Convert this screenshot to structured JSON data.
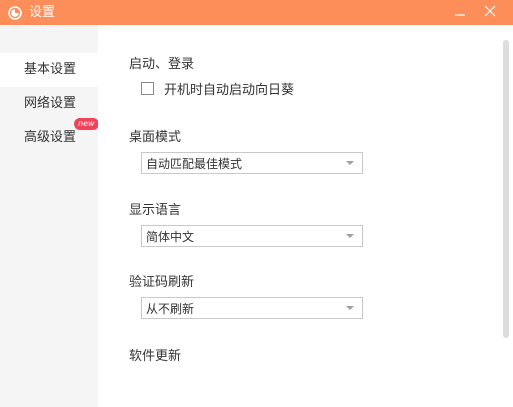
{
  "window": {
    "title": "设置",
    "icons": {
      "app": "app-logo-icon",
      "minimize": "minimize-icon",
      "close": "close-icon"
    },
    "colors": {
      "titlebar": "#fd8d59",
      "badge": "#f0435a"
    }
  },
  "sidebar": {
    "items": [
      {
        "label": "基本设置",
        "active": true
      },
      {
        "label": "网络设置",
        "active": false
      },
      {
        "label": "高级设置",
        "active": false,
        "badge": "new"
      }
    ]
  },
  "main": {
    "startup": {
      "title": "启动、登录",
      "checkbox_label": "开机时自动启动向日葵",
      "checked": false
    },
    "desktop_mode": {
      "title": "桌面模式",
      "selected": "自动匹配最佳模式"
    },
    "language": {
      "title": "显示语言",
      "selected": "简体中文"
    },
    "captcha_refresh": {
      "title": "验证码刷新",
      "selected": "从不刷新"
    },
    "software_update": {
      "title": "软件更新"
    }
  }
}
